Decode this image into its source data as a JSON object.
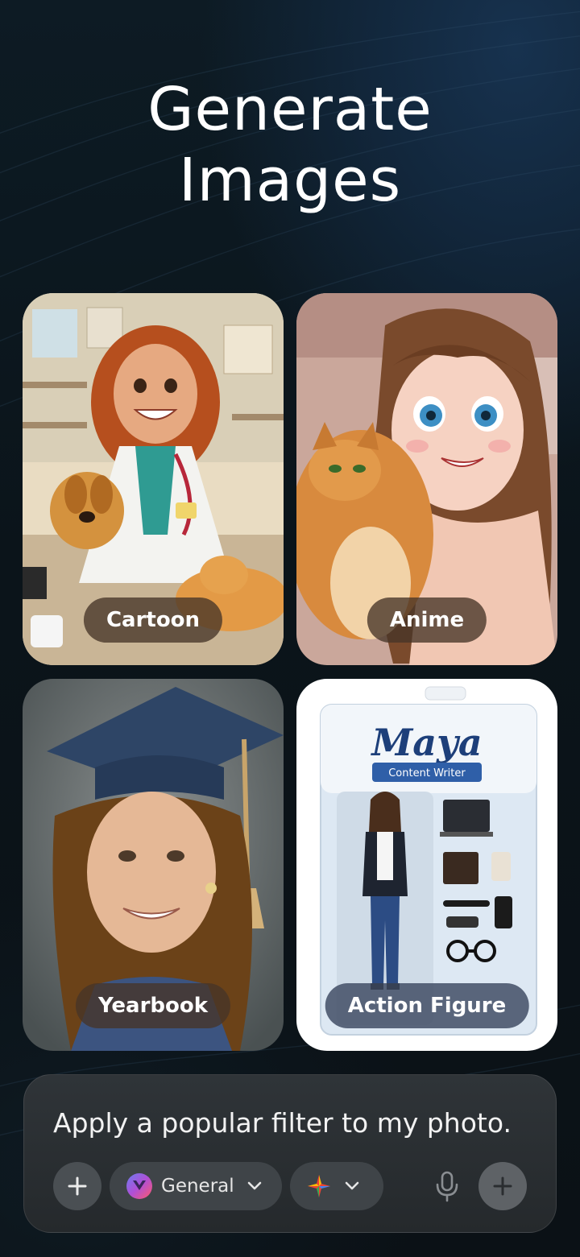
{
  "hero": {
    "title": "Generate\nImages"
  },
  "styles": [
    {
      "label": "Cartoon"
    },
    {
      "label": "Anime"
    },
    {
      "label": "Yearbook"
    },
    {
      "label": "Action Figure"
    }
  ],
  "action_figure_package": {
    "name": "Maya",
    "role": "Content Writer"
  },
  "composer": {
    "prompt": "Apply a popular filter to my photo.",
    "mode_label": "General",
    "icons": {
      "add": "plus-icon",
      "mode": "general-mode-icon",
      "model": "sparkle-icon",
      "mic": "microphone-icon",
      "send": "plus-icon"
    }
  },
  "colors": {
    "background": "#0d1b24",
    "composer": "#2f3438",
    "pill": "#3f4448"
  }
}
